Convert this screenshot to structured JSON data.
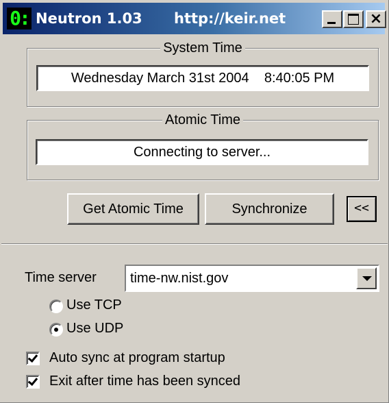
{
  "window": {
    "logo": "0:",
    "app_title": "Neutron 1.03",
    "url": "http://keir.net",
    "controls": {
      "minimize": "minimize-icon",
      "maximize": "maximize-icon",
      "close": "×"
    }
  },
  "system_time": {
    "label": "System Time",
    "value": "Wednesday March 31st 2004    8:40:05 PM"
  },
  "atomic_time": {
    "label": "Atomic Time",
    "value": "Connecting to server..."
  },
  "actions": {
    "get_atomic": "Get Atomic Time",
    "synchronize": "Synchronize",
    "collapse": "<<"
  },
  "settings": {
    "time_server_label": "Time server",
    "time_server_value": "time-nw.nist.gov",
    "protocol": {
      "tcp_label": "Use TCP",
      "udp_label": "Use UDP",
      "selected": "UDP"
    },
    "auto_sync_label": "Auto sync at program startup",
    "auto_sync_checked": true,
    "exit_after_label": "Exit after time has been synced",
    "exit_after_checked": true
  },
  "colors": {
    "title_gradient_start": "#0a246a",
    "title_gradient_end": "#a6caf0",
    "window_face": "#d4d0c8",
    "logo_green": "#19ff19"
  }
}
